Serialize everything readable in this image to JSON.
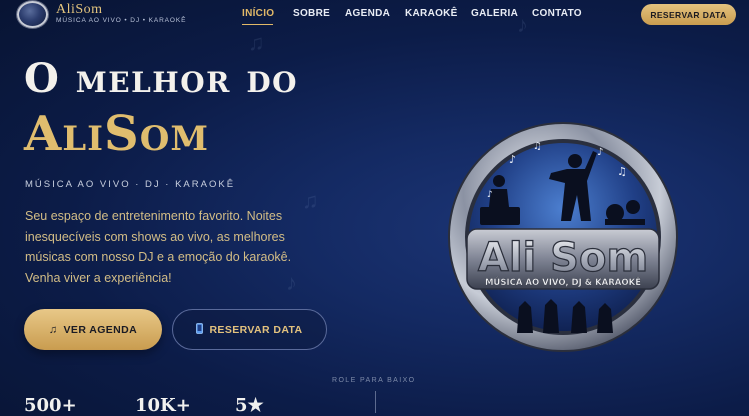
{
  "brand": {
    "name": "AliSom",
    "tagline": "MÚSICA AO VIVO • DJ • KARAOKÊ",
    "gold": "#e2b968",
    "navy": "#0c1c48"
  },
  "nav": {
    "items": [
      {
        "label": "INÍCIO",
        "active": true
      },
      {
        "label": "SOBRE",
        "active": false
      },
      {
        "label": "AGENDA",
        "active": false
      },
      {
        "label": "KARAOKÊ",
        "active": false
      },
      {
        "label": "GALERIA",
        "active": false
      },
      {
        "label": "CONTATO",
        "active": false
      }
    ],
    "cta_label": "RESERVAR DATA"
  },
  "hero": {
    "title_line1": "O melhor do",
    "title_line2": "AliSom",
    "subtitle": "MÚSICA AO VIVO · DJ · KARAOKÊ",
    "description": "Seu espaço de entretenimento favorito. Noites inesquecíveis com shows ao vivo, as melhores músicas com nosso DJ e a emoção do karaokê. Venha viver a experiência!",
    "primary_button": {
      "icon": "music-note-icon",
      "label": "VER AGENDA"
    },
    "secondary_button": {
      "icon": "phone-icon",
      "label": "RESERVAR DATA"
    }
  },
  "stats": [
    {
      "value": "500+"
    },
    {
      "value": "10K+"
    },
    {
      "value": "5★"
    }
  ],
  "scroll_hint": "ROLE PARA BAIXO",
  "emblem": {
    "title": "Ali Som",
    "subtitle": "MÚSICA AO VIVO, DJ & KARAOKÊ"
  }
}
